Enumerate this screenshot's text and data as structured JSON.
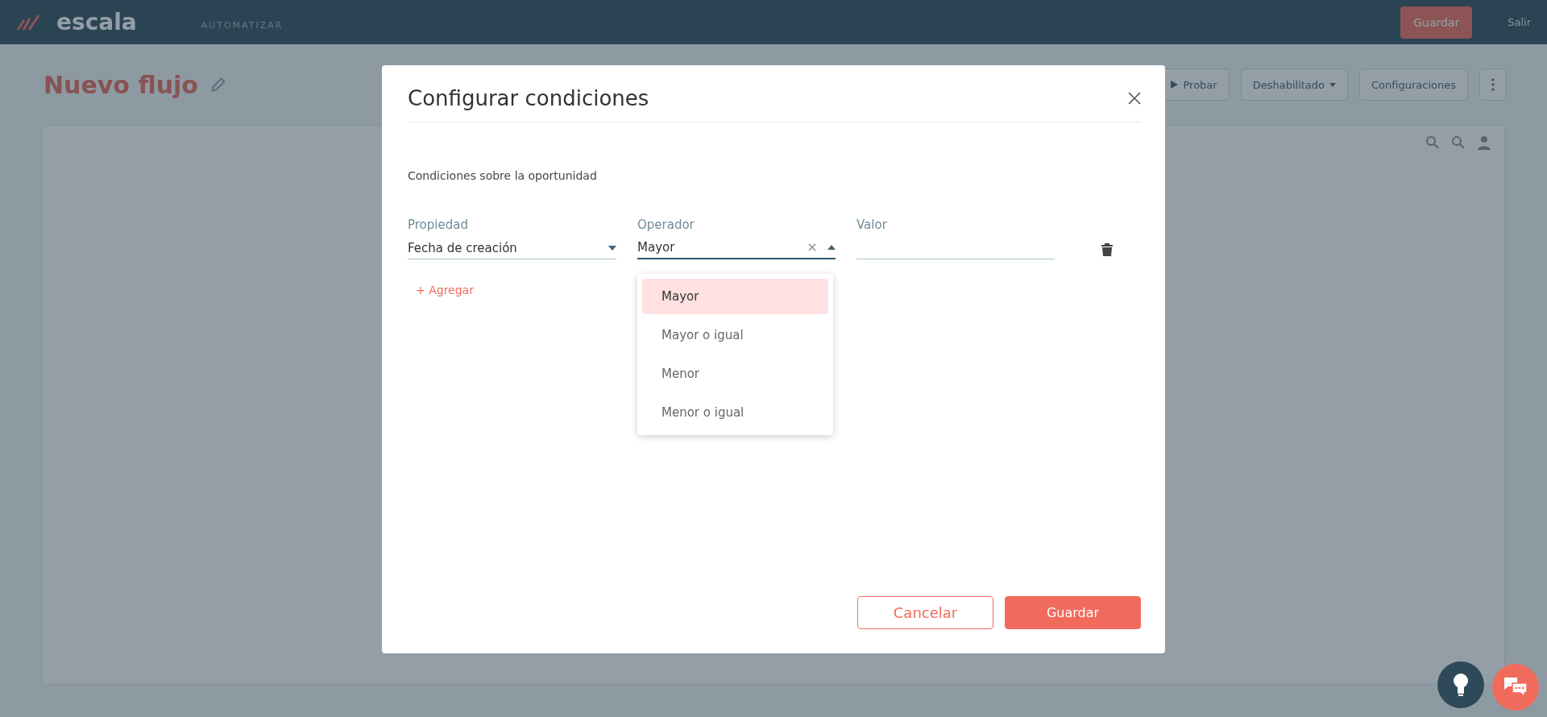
{
  "topbar": {
    "logo": "escala",
    "section": "AUTOMATIZAR",
    "save_button": "Guardar",
    "exit": "Salir"
  },
  "header": {
    "title": "Nuevo flujo",
    "buttons": [
      {
        "kind": "icon-text",
        "label": "Probar"
      },
      {
        "kind": "dropdown",
        "label": "Deshabilitado"
      },
      {
        "kind": "text",
        "label": "Configuraciones"
      },
      {
        "kind": "more"
      }
    ]
  },
  "dialog": {
    "title": "Configurar condiciones",
    "subtitle": "Condiciones sobre la oportunidad",
    "fields": [
      {
        "kind": "select",
        "label": "Propiedad",
        "value": "Fecha de creación",
        "focused": false,
        "open": false
      },
      {
        "kind": "select",
        "label": "Operador",
        "value": "Mayor",
        "focused": true,
        "open": true
      },
      {
        "kind": "text",
        "label": "Valor",
        "focused": false
      }
    ],
    "add_link": "+ Agregar",
    "options": [
      {
        "label": "Mayor",
        "selected": true
      },
      {
        "label": "Mayor o igual",
        "selected": false
      },
      {
        "label": "Menor",
        "selected": false
      },
      {
        "label": "Menor o igual",
        "selected": false
      }
    ],
    "cancel": "Cancelar",
    "save": "Guardar"
  }
}
